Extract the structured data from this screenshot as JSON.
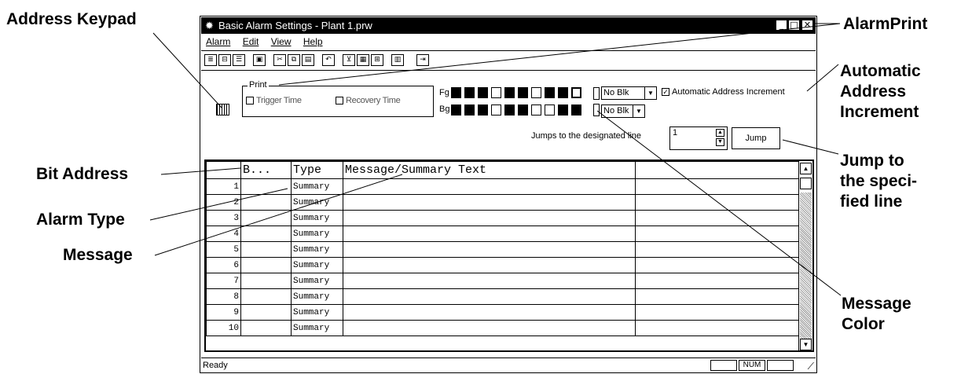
{
  "callouts": {
    "address_keypad": "Address Keypad",
    "alarm_print": "AlarmPrint",
    "automatic_address_increment": [
      "Automatic",
      "Address",
      "Increment"
    ],
    "jump_to_line": [
      "Jump to",
      "the speci-",
      "fied line"
    ],
    "bit_address": "Bit Address",
    "alarm_type": "Alarm Type",
    "message": "Message",
    "message_color": [
      "Message",
      "Color"
    ]
  },
  "window": {
    "title": "Basic Alarm Settings - Plant 1.prw",
    "menu": [
      "Alarm",
      "Edit",
      "View",
      "Help"
    ]
  },
  "settings": {
    "print_label": "Print",
    "trigger_time": "Trigger Time",
    "recovery_time": "Recovery Time",
    "fg_label": "Fg",
    "bg_label": "Bg",
    "fg_blink": "No Blk",
    "bg_blink": "No Blk",
    "auto_increment_label": "Automatic Address Increment",
    "auto_increment_checked": true,
    "jump_hint": "Jumps to the designated line",
    "jump_value": "1",
    "jump_button": "Jump"
  },
  "table": {
    "headers": [
      "B...",
      "Type",
      "Message/Summary Text"
    ],
    "rows": [
      {
        "n": "1",
        "type": "Summary"
      },
      {
        "n": "2",
        "type": "Summary"
      },
      {
        "n": "3",
        "type": "Summary"
      },
      {
        "n": "4",
        "type": "Summary"
      },
      {
        "n": "5",
        "type": "Summary"
      },
      {
        "n": "6",
        "type": "Summary"
      },
      {
        "n": "7",
        "type": "Summary"
      },
      {
        "n": "8",
        "type": "Summary"
      },
      {
        "n": "9",
        "type": "Summary"
      },
      {
        "n": "10",
        "type": "Summary"
      }
    ]
  },
  "status": {
    "text": "Ready",
    "num": "NUM"
  }
}
